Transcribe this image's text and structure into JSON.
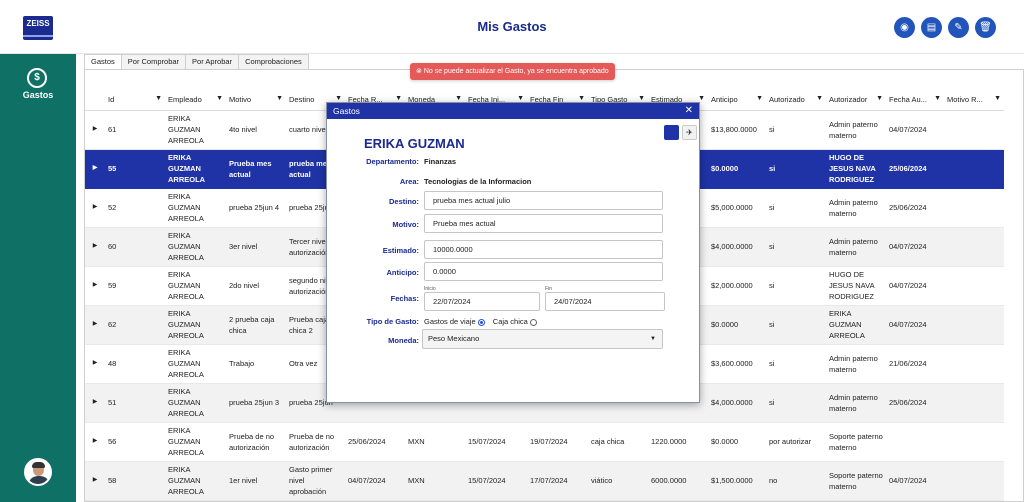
{
  "header": {
    "logo_text": "ZEISS",
    "title": "Mis Gastos",
    "buttons": [
      {
        "name": "view-icon",
        "glyph": "◉"
      },
      {
        "name": "document-icon",
        "glyph": "▤"
      },
      {
        "name": "edit-icon",
        "glyph": "✎"
      },
      {
        "name": "trash-icon",
        "glyph": "🗑"
      }
    ]
  },
  "sidebar": {
    "icon_glyph": "$",
    "label": "Gastos"
  },
  "tabs": [
    "Gastos",
    "Por Comprobar",
    "Por Aprobar",
    "Comprobaciones"
  ],
  "toast": {
    "icon": "⊗",
    "message": "No se puede actualizar el Gasto, ya se encuentra aprobado"
  },
  "table": {
    "columns": [
      "Id",
      "Empleado",
      "Motivo",
      "Destino",
      "Fecha R...",
      "Moneda",
      "Fecha Ini...",
      "Fecha Fin",
      "Tipo Gasto",
      "Estimado",
      "Anticipo",
      "Autorizado",
      "Autorizador",
      "Fecha Au...",
      "Motivo R..."
    ],
    "filter_glyph": "▼",
    "toggle_glyph": "▶",
    "rows": [
      [
        "61",
        "ERIKA GUZMAN ARREOLA",
        "4to nivel",
        "cuarto nivel",
        "",
        "",
        "",
        "",
        "",
        "",
        "$13,800.0000",
        "si",
        "Admin paterno materno",
        "04/07/2024",
        ""
      ],
      [
        "55",
        "ERIKA GUZMAN ARREOLA",
        "Prueba mes actual",
        "prueba mes actual",
        "",
        "",
        "",
        "",
        "",
        "",
        "$0.0000",
        "si",
        "HUGO DE JESUS NAVA RODRIGUEZ",
        "25/06/2024",
        ""
      ],
      [
        "52",
        "ERIKA GUZMAN ARREOLA",
        "prueba 25jun 4",
        "prueba 25jun",
        "",
        "",
        "",
        "",
        "",
        "",
        "$5,000.0000",
        "si",
        "Admin paterno materno",
        "25/06/2024",
        ""
      ],
      [
        "60",
        "ERIKA GUZMAN ARREOLA",
        "3er nivel",
        "Tercer nivel autorización",
        "",
        "",
        "",
        "",
        "",
        "",
        "$4,000.0000",
        "si",
        "Admin paterno materno",
        "04/07/2024",
        ""
      ],
      [
        "59",
        "ERIKA GUZMAN ARREOLA",
        "2do nivel",
        "segundo nivel autorización",
        "",
        "",
        "",
        "",
        "",
        "",
        "$2,000.0000",
        "si",
        "HUGO DE JESUS NAVA RODRIGUEZ",
        "04/07/2024",
        ""
      ],
      [
        "62",
        "ERIKA GUZMAN ARREOLA",
        "2 prueba caja chica",
        "Prueba caja chica 2",
        "",
        "",
        "",
        "",
        "",
        "",
        "$0.0000",
        "si",
        "ERIKA GUZMAN ARREOLA",
        "04/07/2024",
        ""
      ],
      [
        "48",
        "ERIKA GUZMAN ARREOLA",
        "Trabajo",
        "Otra vez",
        "",
        "",
        "",
        "",
        "",
        "",
        "$3,600.0000",
        "si",
        "Admin paterno materno",
        "21/06/2024",
        ""
      ],
      [
        "51",
        "ERIKA GUZMAN ARREOLA",
        "prueba 25jun 3",
        "prueba 25jun",
        "",
        "",
        "",
        "",
        "",
        "",
        "$4,000.0000",
        "si",
        "Admin paterno materno",
        "25/06/2024",
        ""
      ],
      [
        "56",
        "ERIKA GUZMAN ARREOLA",
        "Prueba de no autorización",
        "Prueba de no autorización",
        "25/06/2024",
        "MXN",
        "15/07/2024",
        "19/07/2024",
        "caja chica",
        "1220.0000",
        "$0.0000",
        "por autorizar",
        "Soporte paterno materno",
        "",
        ""
      ],
      [
        "58",
        "ERIKA GUZMAN ARREOLA",
        "1er nivel",
        "Gasto primer nivel aprobación",
        "04/07/2024",
        "MXN",
        "15/07/2024",
        "17/07/2024",
        "viático",
        "6000.0000",
        "$1,500.0000",
        "no",
        "Soporte paterno materno",
        "04/07/2024",
        ""
      ]
    ],
    "selected_index": 1
  },
  "modal": {
    "title": "Gastos",
    "close_glyph": "✕",
    "tool_glyph": "✈",
    "employee_name": "ERIKA GUZMAN",
    "departamento_label": "Departamento:",
    "departamento_value": "Finanzas",
    "area_label": "Area:",
    "area_value": "Tecnologias de la Informacion",
    "destino_label": "Destino:",
    "destino_value": "prueba mes actual julio",
    "motivo_label": "Motivo:",
    "motivo_value": "Prueba mes actual",
    "estimado_label": "Estimado:",
    "estimado_value": "10000.0000",
    "anticipo_label": "Anticipo:",
    "anticipo_value": "0.0000",
    "fechas_label": "Fechas:",
    "inicio_label": "Inicio",
    "inicio_value": "22/07/2024",
    "fin_label": "Fin",
    "fin_value": "24/07/2024",
    "tipo_label": "Tipo de Gasto:",
    "tipo_option1": "Gastos de viaje",
    "tipo_option2": "Caja chica",
    "tipo_selected": "Gastos de viaje",
    "moneda_label": "Moneda:",
    "moneda_value": "Peso Mexicano"
  },
  "colors": {
    "brand": "#1a2a8f",
    "sidebar": "#0f7065",
    "selected_row": "#2033a6",
    "toast": "#e45a58"
  }
}
